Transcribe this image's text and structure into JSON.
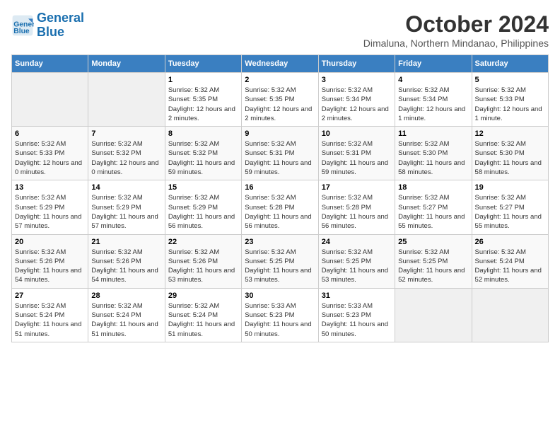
{
  "header": {
    "logo_line1": "General",
    "logo_line2": "Blue",
    "month_year": "October 2024",
    "location": "Dimaluna, Northern Mindanao, Philippines"
  },
  "days_of_week": [
    "Sunday",
    "Monday",
    "Tuesday",
    "Wednesday",
    "Thursday",
    "Friday",
    "Saturday"
  ],
  "weeks": [
    [
      {
        "day": "",
        "info": ""
      },
      {
        "day": "",
        "info": ""
      },
      {
        "day": "1",
        "info": "Sunrise: 5:32 AM\nSunset: 5:35 PM\nDaylight: 12 hours and 2 minutes."
      },
      {
        "day": "2",
        "info": "Sunrise: 5:32 AM\nSunset: 5:35 PM\nDaylight: 12 hours and 2 minutes."
      },
      {
        "day": "3",
        "info": "Sunrise: 5:32 AM\nSunset: 5:34 PM\nDaylight: 12 hours and 2 minutes."
      },
      {
        "day": "4",
        "info": "Sunrise: 5:32 AM\nSunset: 5:34 PM\nDaylight: 12 hours and 1 minute."
      },
      {
        "day": "5",
        "info": "Sunrise: 5:32 AM\nSunset: 5:33 PM\nDaylight: 12 hours and 1 minute."
      }
    ],
    [
      {
        "day": "6",
        "info": "Sunrise: 5:32 AM\nSunset: 5:33 PM\nDaylight: 12 hours and 0 minutes."
      },
      {
        "day": "7",
        "info": "Sunrise: 5:32 AM\nSunset: 5:32 PM\nDaylight: 12 hours and 0 minutes."
      },
      {
        "day": "8",
        "info": "Sunrise: 5:32 AM\nSunset: 5:32 PM\nDaylight: 11 hours and 59 minutes."
      },
      {
        "day": "9",
        "info": "Sunrise: 5:32 AM\nSunset: 5:31 PM\nDaylight: 11 hours and 59 minutes."
      },
      {
        "day": "10",
        "info": "Sunrise: 5:32 AM\nSunset: 5:31 PM\nDaylight: 11 hours and 59 minutes."
      },
      {
        "day": "11",
        "info": "Sunrise: 5:32 AM\nSunset: 5:30 PM\nDaylight: 11 hours and 58 minutes."
      },
      {
        "day": "12",
        "info": "Sunrise: 5:32 AM\nSunset: 5:30 PM\nDaylight: 11 hours and 58 minutes."
      }
    ],
    [
      {
        "day": "13",
        "info": "Sunrise: 5:32 AM\nSunset: 5:29 PM\nDaylight: 11 hours and 57 minutes."
      },
      {
        "day": "14",
        "info": "Sunrise: 5:32 AM\nSunset: 5:29 PM\nDaylight: 11 hours and 57 minutes."
      },
      {
        "day": "15",
        "info": "Sunrise: 5:32 AM\nSunset: 5:29 PM\nDaylight: 11 hours and 56 minutes."
      },
      {
        "day": "16",
        "info": "Sunrise: 5:32 AM\nSunset: 5:28 PM\nDaylight: 11 hours and 56 minutes."
      },
      {
        "day": "17",
        "info": "Sunrise: 5:32 AM\nSunset: 5:28 PM\nDaylight: 11 hours and 56 minutes."
      },
      {
        "day": "18",
        "info": "Sunrise: 5:32 AM\nSunset: 5:27 PM\nDaylight: 11 hours and 55 minutes."
      },
      {
        "day": "19",
        "info": "Sunrise: 5:32 AM\nSunset: 5:27 PM\nDaylight: 11 hours and 55 minutes."
      }
    ],
    [
      {
        "day": "20",
        "info": "Sunrise: 5:32 AM\nSunset: 5:26 PM\nDaylight: 11 hours and 54 minutes."
      },
      {
        "day": "21",
        "info": "Sunrise: 5:32 AM\nSunset: 5:26 PM\nDaylight: 11 hours and 54 minutes."
      },
      {
        "day": "22",
        "info": "Sunrise: 5:32 AM\nSunset: 5:26 PM\nDaylight: 11 hours and 53 minutes."
      },
      {
        "day": "23",
        "info": "Sunrise: 5:32 AM\nSunset: 5:25 PM\nDaylight: 11 hours and 53 minutes."
      },
      {
        "day": "24",
        "info": "Sunrise: 5:32 AM\nSunset: 5:25 PM\nDaylight: 11 hours and 53 minutes."
      },
      {
        "day": "25",
        "info": "Sunrise: 5:32 AM\nSunset: 5:25 PM\nDaylight: 11 hours and 52 minutes."
      },
      {
        "day": "26",
        "info": "Sunrise: 5:32 AM\nSunset: 5:24 PM\nDaylight: 11 hours and 52 minutes."
      }
    ],
    [
      {
        "day": "27",
        "info": "Sunrise: 5:32 AM\nSunset: 5:24 PM\nDaylight: 11 hours and 51 minutes."
      },
      {
        "day": "28",
        "info": "Sunrise: 5:32 AM\nSunset: 5:24 PM\nDaylight: 11 hours and 51 minutes."
      },
      {
        "day": "29",
        "info": "Sunrise: 5:32 AM\nSunset: 5:24 PM\nDaylight: 11 hours and 51 minutes."
      },
      {
        "day": "30",
        "info": "Sunrise: 5:33 AM\nSunset: 5:23 PM\nDaylight: 11 hours and 50 minutes."
      },
      {
        "day": "31",
        "info": "Sunrise: 5:33 AM\nSunset: 5:23 PM\nDaylight: 11 hours and 50 minutes."
      },
      {
        "day": "",
        "info": ""
      },
      {
        "day": "",
        "info": ""
      }
    ]
  ]
}
